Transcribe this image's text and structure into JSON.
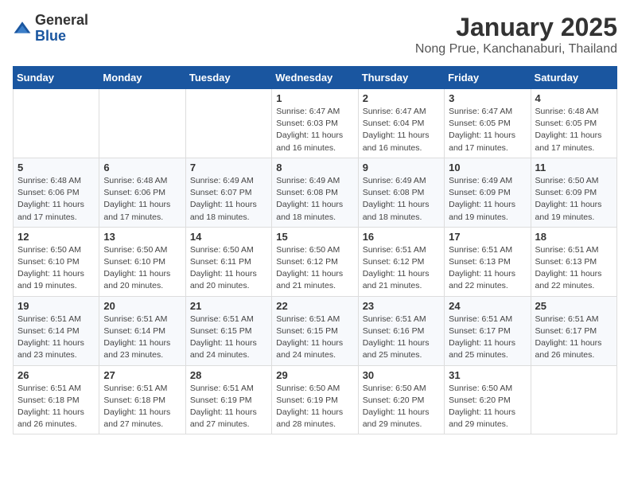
{
  "header": {
    "logo_general": "General",
    "logo_blue": "Blue",
    "month": "January 2025",
    "location": "Nong Prue, Kanchanaburi, Thailand"
  },
  "days_of_week": [
    "Sunday",
    "Monday",
    "Tuesday",
    "Wednesday",
    "Thursday",
    "Friday",
    "Saturday"
  ],
  "weeks": [
    [
      {
        "day": "",
        "info": ""
      },
      {
        "day": "",
        "info": ""
      },
      {
        "day": "",
        "info": ""
      },
      {
        "day": "1",
        "info": "Sunrise: 6:47 AM\nSunset: 6:03 PM\nDaylight: 11 hours and 16 minutes."
      },
      {
        "day": "2",
        "info": "Sunrise: 6:47 AM\nSunset: 6:04 PM\nDaylight: 11 hours and 16 minutes."
      },
      {
        "day": "3",
        "info": "Sunrise: 6:47 AM\nSunset: 6:05 PM\nDaylight: 11 hours and 17 minutes."
      },
      {
        "day": "4",
        "info": "Sunrise: 6:48 AM\nSunset: 6:05 PM\nDaylight: 11 hours and 17 minutes."
      }
    ],
    [
      {
        "day": "5",
        "info": "Sunrise: 6:48 AM\nSunset: 6:06 PM\nDaylight: 11 hours and 17 minutes."
      },
      {
        "day": "6",
        "info": "Sunrise: 6:48 AM\nSunset: 6:06 PM\nDaylight: 11 hours and 17 minutes."
      },
      {
        "day": "7",
        "info": "Sunrise: 6:49 AM\nSunset: 6:07 PM\nDaylight: 11 hours and 18 minutes."
      },
      {
        "day": "8",
        "info": "Sunrise: 6:49 AM\nSunset: 6:08 PM\nDaylight: 11 hours and 18 minutes."
      },
      {
        "day": "9",
        "info": "Sunrise: 6:49 AM\nSunset: 6:08 PM\nDaylight: 11 hours and 18 minutes."
      },
      {
        "day": "10",
        "info": "Sunrise: 6:49 AM\nSunset: 6:09 PM\nDaylight: 11 hours and 19 minutes."
      },
      {
        "day": "11",
        "info": "Sunrise: 6:50 AM\nSunset: 6:09 PM\nDaylight: 11 hours and 19 minutes."
      }
    ],
    [
      {
        "day": "12",
        "info": "Sunrise: 6:50 AM\nSunset: 6:10 PM\nDaylight: 11 hours and 19 minutes."
      },
      {
        "day": "13",
        "info": "Sunrise: 6:50 AM\nSunset: 6:10 PM\nDaylight: 11 hours and 20 minutes."
      },
      {
        "day": "14",
        "info": "Sunrise: 6:50 AM\nSunset: 6:11 PM\nDaylight: 11 hours and 20 minutes."
      },
      {
        "day": "15",
        "info": "Sunrise: 6:50 AM\nSunset: 6:12 PM\nDaylight: 11 hours and 21 minutes."
      },
      {
        "day": "16",
        "info": "Sunrise: 6:51 AM\nSunset: 6:12 PM\nDaylight: 11 hours and 21 minutes."
      },
      {
        "day": "17",
        "info": "Sunrise: 6:51 AM\nSunset: 6:13 PM\nDaylight: 11 hours and 22 minutes."
      },
      {
        "day": "18",
        "info": "Sunrise: 6:51 AM\nSunset: 6:13 PM\nDaylight: 11 hours and 22 minutes."
      }
    ],
    [
      {
        "day": "19",
        "info": "Sunrise: 6:51 AM\nSunset: 6:14 PM\nDaylight: 11 hours and 23 minutes."
      },
      {
        "day": "20",
        "info": "Sunrise: 6:51 AM\nSunset: 6:14 PM\nDaylight: 11 hours and 23 minutes."
      },
      {
        "day": "21",
        "info": "Sunrise: 6:51 AM\nSunset: 6:15 PM\nDaylight: 11 hours and 24 minutes."
      },
      {
        "day": "22",
        "info": "Sunrise: 6:51 AM\nSunset: 6:15 PM\nDaylight: 11 hours and 24 minutes."
      },
      {
        "day": "23",
        "info": "Sunrise: 6:51 AM\nSunset: 6:16 PM\nDaylight: 11 hours and 25 minutes."
      },
      {
        "day": "24",
        "info": "Sunrise: 6:51 AM\nSunset: 6:17 PM\nDaylight: 11 hours and 25 minutes."
      },
      {
        "day": "25",
        "info": "Sunrise: 6:51 AM\nSunset: 6:17 PM\nDaylight: 11 hours and 26 minutes."
      }
    ],
    [
      {
        "day": "26",
        "info": "Sunrise: 6:51 AM\nSunset: 6:18 PM\nDaylight: 11 hours and 26 minutes."
      },
      {
        "day": "27",
        "info": "Sunrise: 6:51 AM\nSunset: 6:18 PM\nDaylight: 11 hours and 27 minutes."
      },
      {
        "day": "28",
        "info": "Sunrise: 6:51 AM\nSunset: 6:19 PM\nDaylight: 11 hours and 27 minutes."
      },
      {
        "day": "29",
        "info": "Sunrise: 6:50 AM\nSunset: 6:19 PM\nDaylight: 11 hours and 28 minutes."
      },
      {
        "day": "30",
        "info": "Sunrise: 6:50 AM\nSunset: 6:20 PM\nDaylight: 11 hours and 29 minutes."
      },
      {
        "day": "31",
        "info": "Sunrise: 6:50 AM\nSunset: 6:20 PM\nDaylight: 11 hours and 29 minutes."
      },
      {
        "day": "",
        "info": ""
      }
    ]
  ]
}
